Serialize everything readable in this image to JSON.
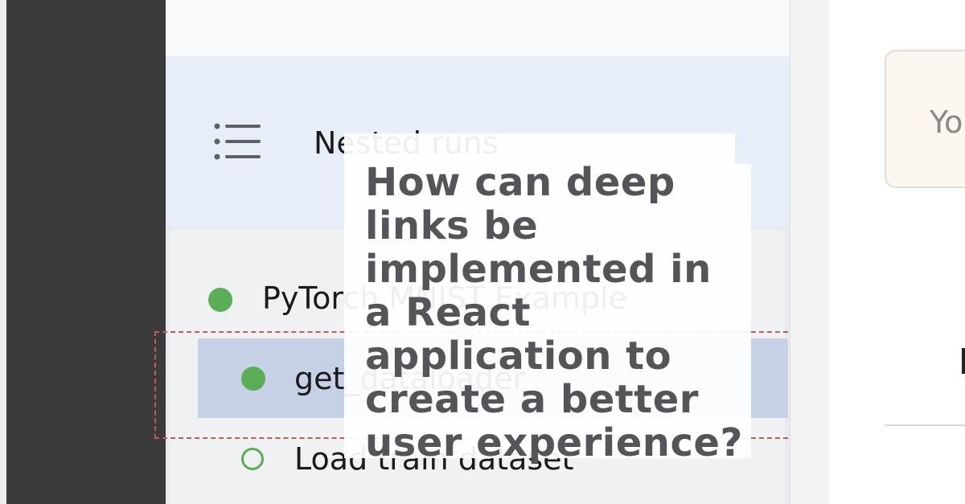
{
  "header": {
    "title": "Nested runs",
    "menu_icon": "hamburger-list-icon"
  },
  "runs": {
    "items": [
      {
        "label": "PyTorch MNIST Example",
        "status": "complete",
        "selected": false
      },
      {
        "label": "get_dataloader",
        "status": "complete",
        "selected": true
      },
      {
        "label": "Load train dataset",
        "status": "pending",
        "selected": false
      }
    ]
  },
  "right_panel": {
    "card_text": "Yo"
  },
  "overlay": {
    "question": "How can deep links be implemented in a React application to create a better user experience?"
  },
  "colors": {
    "status_complete": "#5cad57",
    "selection": "#c6d1e6",
    "dashed_highlight": "#c25a5a"
  }
}
